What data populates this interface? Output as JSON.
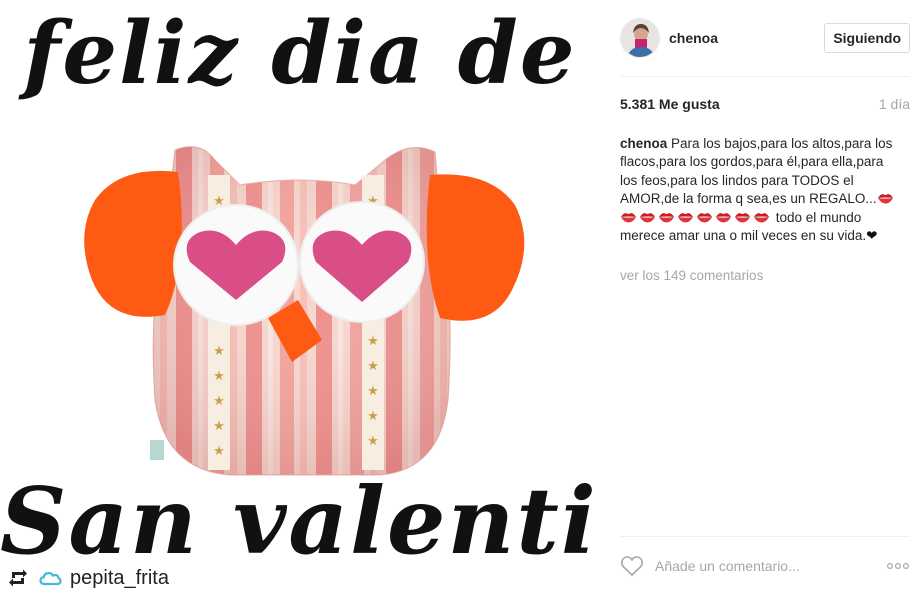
{
  "post": {
    "title_top": "feliz dia de",
    "title_bottom": "San valentin",
    "repost_user": "pepita_frita"
  },
  "header": {
    "username": "chenoa",
    "follow_label": "Siguiendo"
  },
  "stats": {
    "likes": "5.381 Me gusta",
    "time": "1 día"
  },
  "caption": {
    "user": "chenoa",
    "text_before": "Para los bajos,para los altos,para los flacos,para los gordos,para él,para ella,para los feos,para los lindos para TODOS el AMOR,de la forma q sea,es un REGALO...",
    "lips_count": 9,
    "text_after": " todo el mundo merece amar una o mil veces en su vida.",
    "heart": "❤"
  },
  "comments": {
    "view_label": "ver los 149 comentarios"
  },
  "comment_box": {
    "placeholder": "Añade un comentario..."
  },
  "icons": {
    "repost": "repost-icon",
    "cloud": "cloud-icon",
    "like": "heart-outline-icon",
    "more": "more-options-icon"
  },
  "colors": {
    "owl_orange": "#ff5a14",
    "owl_pink_heart": "#d94e86",
    "owl_stripe_pink": "#f2a2a0",
    "secondary_text": "#a5a7aa",
    "divider": "#efefef"
  }
}
